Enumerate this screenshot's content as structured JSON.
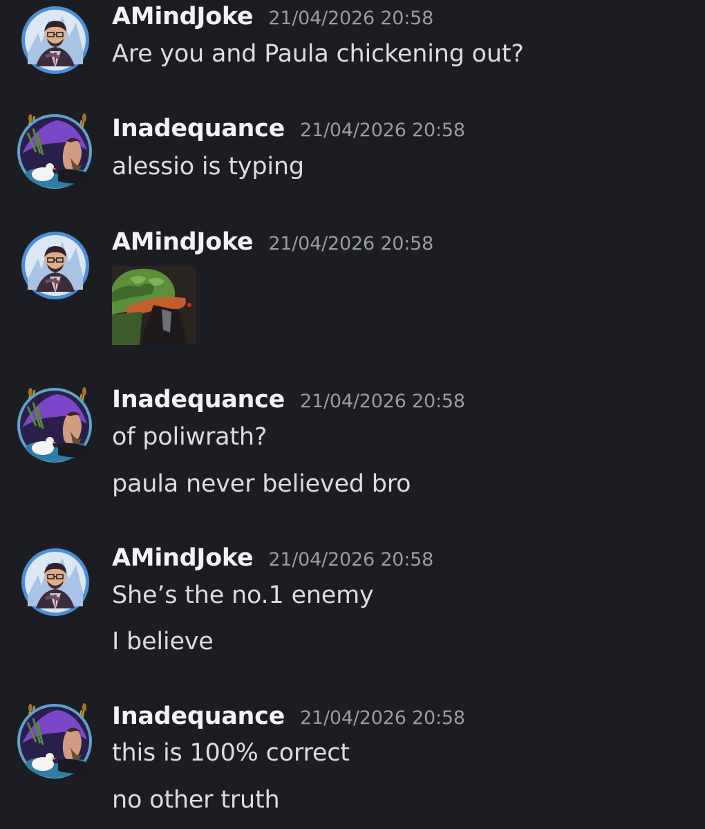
{
  "messages": [
    {
      "author": "AMindJoke",
      "timestamp": "21/04/2026 20:58",
      "lines": [
        "Are you and Paula chickening out?"
      ]
    },
    {
      "author": "Inadequance",
      "timestamp": "21/04/2026 20:58",
      "lines": [
        "alessio is typing"
      ]
    },
    {
      "author": "AMindJoke",
      "timestamp": "21/04/2026 20:58",
      "lines": [],
      "attachment": "pepe-emote"
    },
    {
      "author": "Inadequance",
      "timestamp": "21/04/2026 20:58",
      "lines": [
        "of poliwrath?",
        "paula never believed bro"
      ]
    },
    {
      "author": "AMindJoke",
      "timestamp": "21/04/2026 20:58",
      "lines": [
        "She’s the no.1 enemy",
        "I believe"
      ]
    },
    {
      "author": "Inadequance",
      "timestamp": "21/04/2026 20:58",
      "lines": [
        "this is 100% correct",
        "no other truth"
      ]
    }
  ],
  "colors": {
    "background": "#1c1d22",
    "username": "#f2f3f5",
    "timestamp": "#9a9ca3",
    "message": "#dcdde0"
  }
}
